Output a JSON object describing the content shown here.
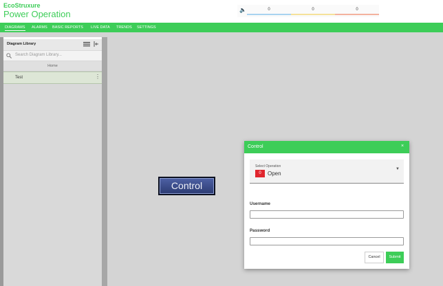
{
  "header": {
    "brand_line": "EcoStruxure",
    "app_title": "Power Operation",
    "alarm_counts": [
      {
        "value": "0",
        "color": "#a8d3f0"
      },
      {
        "value": "0",
        "color": "#f5e19a"
      },
      {
        "value": "0",
        "color": "#f3b29e"
      }
    ]
  },
  "nav": {
    "items": [
      {
        "label": "DIAGRAMS",
        "active": true
      },
      {
        "label": "ALARMS"
      },
      {
        "label": "BASIC REPORTS"
      },
      {
        "label": "LIVE DATA"
      },
      {
        "label": "TRENDS"
      },
      {
        "label": "SETTINGS"
      }
    ]
  },
  "library": {
    "title": "Diagram Library",
    "search_placeholder": "Search Diagram Library...",
    "home_label": "Home",
    "items": [
      {
        "label": "Test"
      }
    ]
  },
  "canvas": {
    "control_button_label": "Control"
  },
  "dialog": {
    "title": "Control",
    "close_glyph": "×",
    "select_label": "Select Operation",
    "selected_code": "0",
    "selected_value": "Open",
    "username_label": "Username",
    "username_value": "",
    "password_label": "Password",
    "password_value": "",
    "cancel_label": "Cancel",
    "submit_label": "Submit"
  },
  "colors": {
    "brand_green": "#3dcd58",
    "badge_red": "#e0262e",
    "control_blue": "#3a4b8c"
  }
}
